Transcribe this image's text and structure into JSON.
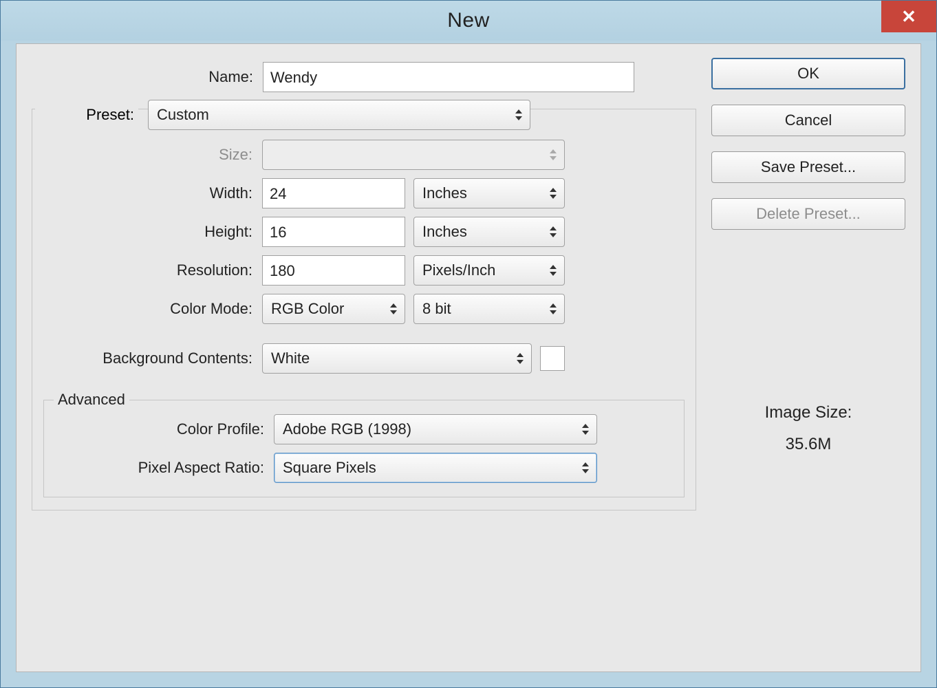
{
  "window": {
    "title": "New",
    "close_glyph": "✕"
  },
  "labels": {
    "name": "Name:",
    "preset": "Preset:",
    "size": "Size:",
    "width": "Width:",
    "height": "Height:",
    "resolution": "Resolution:",
    "color_mode": "Color Mode:",
    "background_contents": "Background Contents:",
    "advanced": "Advanced",
    "color_profile": "Color Profile:",
    "pixel_aspect_ratio": "Pixel Aspect Ratio:"
  },
  "values": {
    "name": "Wendy",
    "preset": "Custom",
    "size": "",
    "width": "24",
    "width_unit": "Inches",
    "height": "16",
    "height_unit": "Inches",
    "resolution": "180",
    "resolution_unit": "Pixels/Inch",
    "color_mode": "RGB Color",
    "color_depth": "8 bit",
    "background_contents": "White",
    "background_color": "#ffffff",
    "color_profile": "Adobe RGB (1998)",
    "pixel_aspect_ratio": "Square Pixels"
  },
  "buttons": {
    "ok": "OK",
    "cancel": "Cancel",
    "save_preset": "Save Preset...",
    "delete_preset": "Delete Preset..."
  },
  "image_size": {
    "label": "Image Size:",
    "value": "35.6M"
  }
}
